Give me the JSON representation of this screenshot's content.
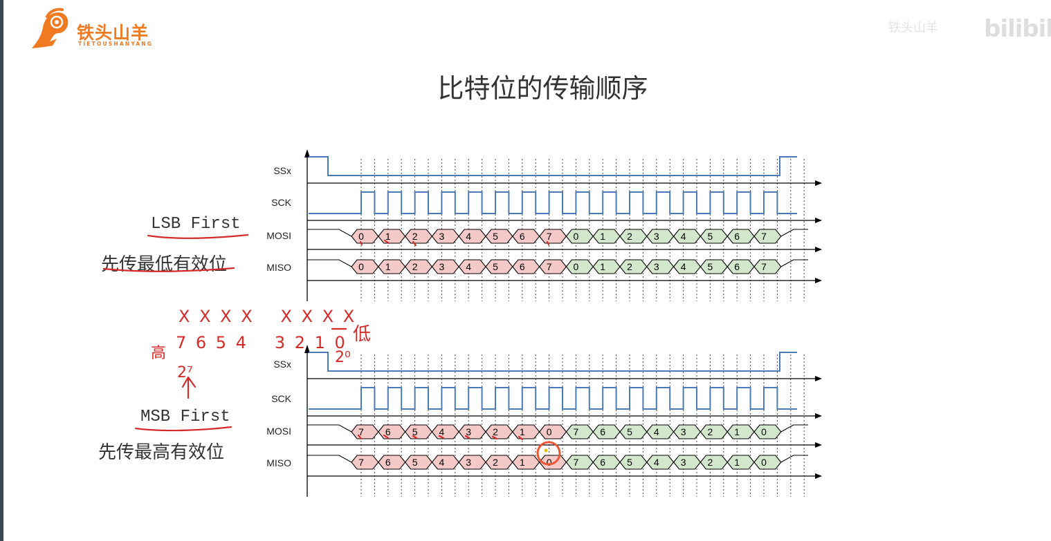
{
  "brand": {
    "name_cn": "铁头山羊",
    "name_en": "TIETOUSHANYANG"
  },
  "watermark": {
    "uploader": "铁头山羊",
    "site_logo": "bilibili"
  },
  "slide": {
    "title": "比特位的传输顺序"
  },
  "sections": {
    "lsb": {
      "label_en": "LSB First",
      "label_cn": "先传最低有效位"
    },
    "msb": {
      "label_en": "MSB First",
      "label_cn": "先传最高有效位"
    }
  },
  "signals": {
    "ss": "SSx",
    "sck": "SCK",
    "mosi": "MOSI",
    "miso": "MISO"
  },
  "bytes": {
    "lsb_order": [
      "0",
      "1",
      "2",
      "3",
      "4",
      "5",
      "6",
      "7"
    ],
    "msb_order": [
      "7",
      "6",
      "5",
      "4",
      "3",
      "2",
      "1",
      "0"
    ]
  },
  "handwriting": {
    "marks": "X X X X   X X X X",
    "digits": "7 6 5 4   3 2 1 0",
    "high": "高",
    "low": "低",
    "pow_high": "2⁷",
    "pow_low": "2⁰"
  },
  "colors": {
    "brand": "#ef7a22",
    "signal": "#4a7ab7",
    "first_byte": "#f6c9c9",
    "second_byte": "#d3e7cd",
    "ink": "#d42a2a"
  }
}
